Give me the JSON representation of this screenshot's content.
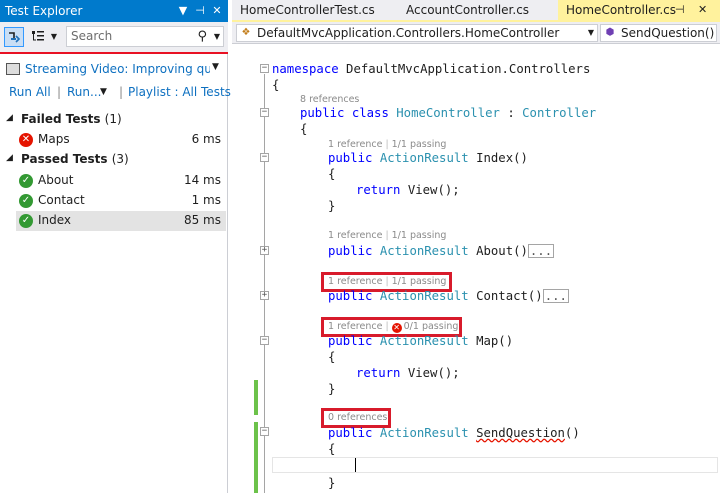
{
  "test_explorer": {
    "title": "Test Explorer",
    "title_buttons": [
      "▼",
      "⊣",
      "✕"
    ],
    "search_placeholder": "Search",
    "playlist_label": "Streaming Video: Improving quality",
    "run_all": "Run All",
    "run": "Run...",
    "playlist": "Playlist : All Tests",
    "failed_group": {
      "label": "Failed Tests",
      "count": "(1)"
    },
    "failed_tests": [
      {
        "name": "Maps",
        "time": "6 ms"
      }
    ],
    "passed_group": {
      "label": "Passed Tests",
      "count": "(3)"
    },
    "passed_tests": [
      {
        "name": "About",
        "time": "14 ms"
      },
      {
        "name": "Contact",
        "time": "1 ms"
      },
      {
        "name": "Index",
        "time": "85 ms"
      }
    ]
  },
  "tabs": [
    {
      "label": "HomeControllerTest.cs",
      "active": false
    },
    {
      "label": "AccountController.cs",
      "active": false
    },
    {
      "label": "HomeController.cs",
      "active": true
    }
  ],
  "navbar": {
    "class_path": "DefaultMvcApplication.Controllers.HomeController",
    "member": "SendQuestion()"
  },
  "code": {
    "ns_kw": "namespace",
    "ns_name": " DefaultMvcApplication.Controllers",
    "class_refs": "8 references",
    "public": "public",
    "class_kw": "class",
    "class_name": "HomeController",
    "base": "Controller",
    "action_result": "ActionResult",
    "return_kw": "return",
    "return_view": " View();",
    "methods": [
      {
        "refs": "1 reference",
        "tests": "1/1 passing",
        "sig": " Index()"
      },
      {
        "refs": "1 reference",
        "tests": "1/1 passing",
        "sig": " About()"
      },
      {
        "refs": "1 reference",
        "tests": "1/1 passing",
        "sig": " Contact()"
      },
      {
        "refs": "1 reference",
        "tests": "0/1 passing",
        "sig": " Map()"
      },
      {
        "refs": "0 references",
        "tests": "",
        "sig": "SendQuestion"
      }
    ],
    "collapsed_marker": "...",
    "sendq_parens": "()"
  },
  "colors": {
    "accent": "#007acc",
    "highlight_box": "#d81b2b",
    "change_bar": "#6cc24a",
    "keyword": "#0000ff",
    "type": "#2b91af"
  }
}
